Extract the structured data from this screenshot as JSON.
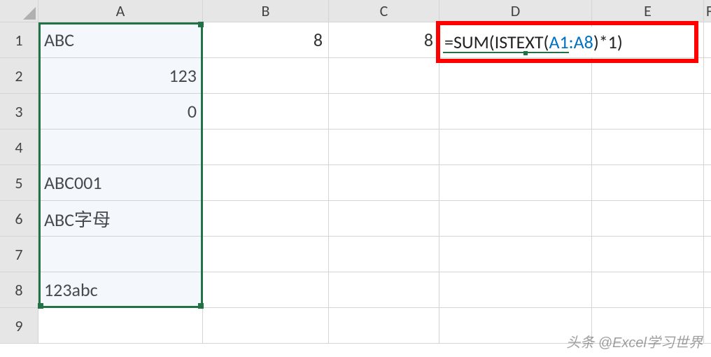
{
  "columns": [
    "A",
    "B",
    "C",
    "D",
    "E",
    "F"
  ],
  "rows": [
    "1",
    "2",
    "3",
    "4",
    "5",
    "6",
    "7",
    "8",
    "9"
  ],
  "cells": {
    "A1": {
      "v": "ABC",
      "align": "left"
    },
    "A2": {
      "v": "123",
      "align": "right"
    },
    "A3": {
      "v": "0",
      "align": "right"
    },
    "A4": {
      "v": "",
      "align": "left"
    },
    "A5": {
      "v": "ABC001",
      "align": "left"
    },
    "A6": {
      "v": "ABC字母",
      "align": "left"
    },
    "A7": {
      "v": "",
      "align": "left"
    },
    "A8": {
      "v": "123abc",
      "align": "left"
    },
    "B1": {
      "v": "8",
      "align": "right"
    },
    "C1": {
      "v": "8",
      "align": "right"
    }
  },
  "formula": {
    "prefix": "=SUM(ISTEXT",
    "ref_open": "(",
    "ref": "A1:A8",
    "ref_close": ")",
    "suffix": "*1)"
  },
  "selection": "A1:A8",
  "watermark": "头条 @Excel学习世界"
}
